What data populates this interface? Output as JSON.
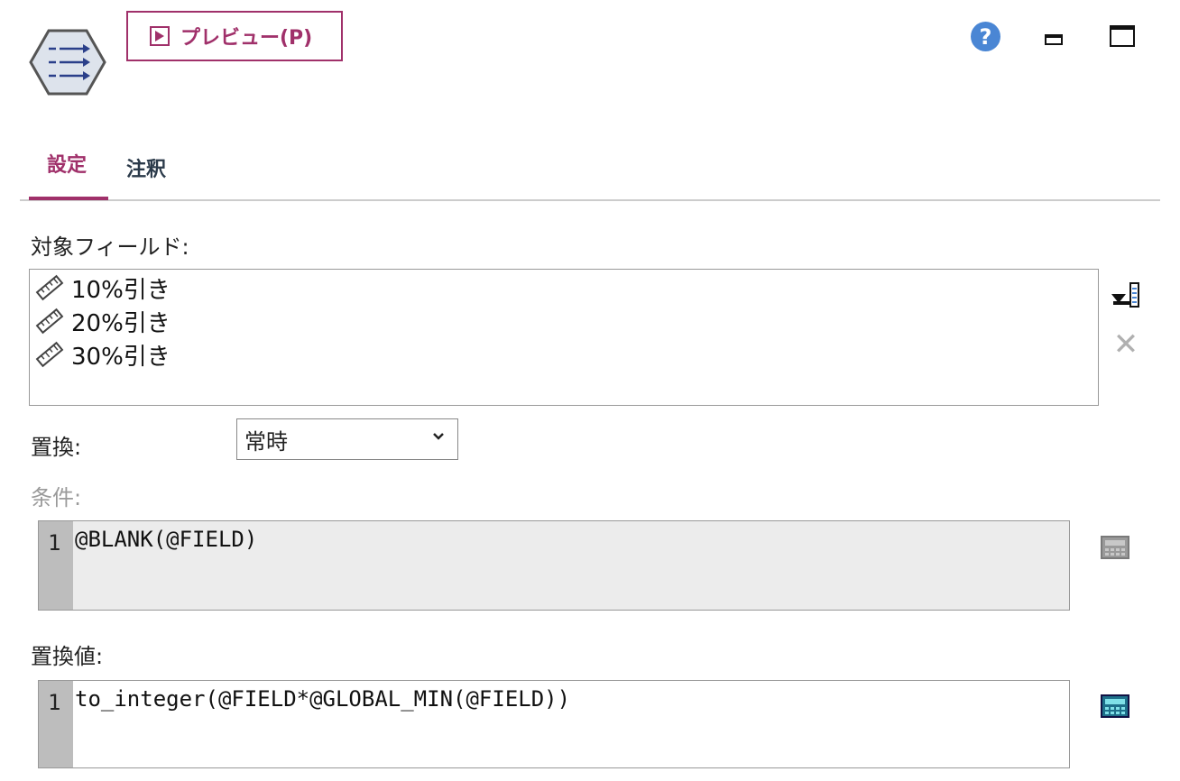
{
  "toolbar": {
    "preview_label": "プレビュー(P)",
    "icons": [
      "node-icon",
      "play-icon",
      "help-icon",
      "minimize-icon",
      "maximize-icon"
    ]
  },
  "tabs": [
    {
      "label": "設定",
      "active": true
    },
    {
      "label": "注釈",
      "active": false
    }
  ],
  "fields_section": {
    "label": "対象フィールド:",
    "items": [
      {
        "label": "10%引き",
        "icon": "ruler-icon"
      },
      {
        "label": "20%引き",
        "icon": "ruler-icon"
      },
      {
        "label": "30%引き",
        "icon": "ruler-icon"
      }
    ]
  },
  "replace": {
    "label": "置換:",
    "selected": "常時"
  },
  "condition": {
    "label": "条件:",
    "line_number": "1",
    "code": "@BLANK(@FIELD)",
    "disabled": true
  },
  "replacement_value": {
    "label": "置換値:",
    "line_number": "1",
    "code": "to_integer(@FIELD*@GLOBAL_MIN(@FIELD))"
  },
  "colors": {
    "accent": "#a0306a",
    "help_blue": "#4a86d4",
    "gutter": "#bdbdbd",
    "disabled_text": "#9a9a9a"
  }
}
